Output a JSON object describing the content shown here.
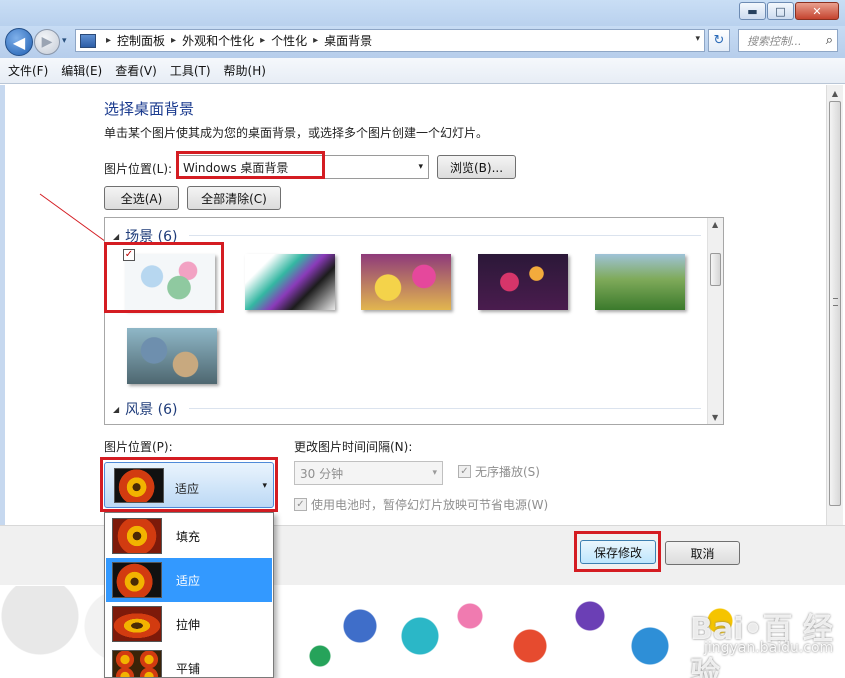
{
  "window": {
    "minimize_icon": "minimize-icon",
    "maximize_icon": "maximize-icon",
    "close_icon": "close-icon",
    "minimize_glyph": "▬",
    "maximize_glyph": "□",
    "close_glyph": "✕"
  },
  "address": {
    "back_glyph": "◀",
    "forward_glyph": "▶",
    "history_glyph": "▾",
    "crumbs": [
      "控制面板",
      "外观和个性化",
      "个性化",
      "桌面背景"
    ],
    "sep_glyph": "▸",
    "refresh_glyph": "↻",
    "search_placeholder": "搜索控制...",
    "search_glyph": "⌕"
  },
  "menu": [
    "文件(F)",
    "编辑(E)",
    "查看(V)",
    "工具(T)",
    "帮助(H)"
  ],
  "main": {
    "heading": "选择桌面背景",
    "description": "单击某个图片使其成为您的桌面背景，或选择多个图片创建一个幻灯片。",
    "location_label": "图片位置(L):",
    "location_value": "Windows 桌面背景",
    "browse_label": "浏览(B)...",
    "select_all_label": "全选(A)",
    "clear_all_label": "全部清除(C)"
  },
  "gallery": {
    "groups": [
      {
        "title": "场景 (6)",
        "collapse_glyph": "◢"
      },
      {
        "title": "风景 (6)",
        "collapse_glyph": "◢"
      }
    ],
    "checked_glyph": "✓"
  },
  "options": {
    "position_label": "图片位置(P):",
    "position_value": "适应",
    "interval_label": "更改图片时间间隔(N):",
    "interval_value": "30 分钟",
    "shuffle_label": "无序播放(S)",
    "shuffle_checked": true,
    "battery_label": "使用电池时，暂停幻灯片放映可节省电源(W)",
    "battery_checked": true,
    "check_glyph": "✓",
    "dropdown_glyph": "▾"
  },
  "dropdown_items": [
    {
      "label": "填充",
      "selected": false
    },
    {
      "label": "适应",
      "selected": true
    },
    {
      "label": "拉伸",
      "selected": false
    },
    {
      "label": "平铺",
      "selected": false
    }
  ],
  "buttons": {
    "save_label": "保存修改",
    "cancel_label": "取消"
  },
  "watermark": {
    "brand": "Bai•百 经验",
    "url": "jingyan.baidu.com"
  },
  "colors": {
    "highlight_box": "#d41c22",
    "selection": "#3399ff",
    "heading": "#1a3a8e"
  }
}
